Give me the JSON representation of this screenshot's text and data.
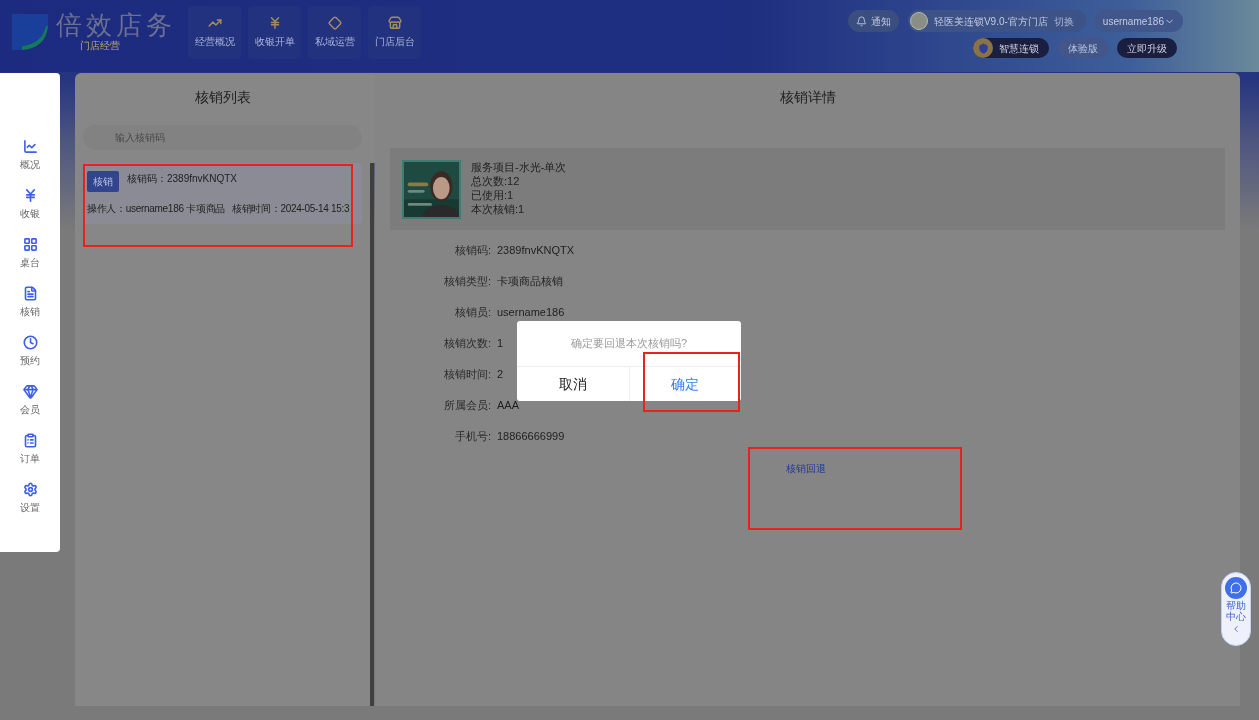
{
  "header": {
    "logo": {
      "title": "倍效店务",
      "subtitle": "门店经营"
    },
    "nav": [
      {
        "label": "经营概况"
      },
      {
        "label": "收银开单"
      },
      {
        "label": "私域运营"
      },
      {
        "label": "门店后台"
      }
    ],
    "notify": "通知",
    "store": "轻医美连锁V9.0-官方门店",
    "switch": "切换",
    "user": "username186",
    "chain_badge": "智慧连锁",
    "edition": "体验版",
    "upgrade": "立即升级"
  },
  "sidebar": {
    "items": [
      {
        "label": "概况"
      },
      {
        "label": "收银"
      },
      {
        "label": "桌台"
      },
      {
        "label": "核销"
      },
      {
        "label": "预约"
      },
      {
        "label": "会员"
      },
      {
        "label": "订单"
      },
      {
        "label": "设置"
      }
    ]
  },
  "list_panel": {
    "title": "核销列表",
    "search": {
      "placeholder": "输入核销码"
    },
    "records": [
      {
        "tag": "核销",
        "code": "核销码：2389fnvKNQTX",
        "operator": "操作人：username186 卡项商品",
        "time": "核销时间：2024-05-14 15:3"
      }
    ]
  },
  "detail_panel": {
    "title": "核销详情",
    "product": {
      "lines": [
        "服务项目-水光-单次",
        "总次数:12",
        "已使用:1",
        "本次核销:1"
      ]
    },
    "fields": [
      {
        "label": "核销码:",
        "value": "2389fnvKNQTX"
      },
      {
        "label": "核销类型:",
        "value": "卡项商品核销"
      },
      {
        "label": "核销员:",
        "value": "username186"
      },
      {
        "label": "核销次数:",
        "value": "1"
      },
      {
        "label": "核销时间:",
        "value": "2"
      },
      {
        "label": "所属会员:",
        "value": "AAA"
      },
      {
        "label": "手机号:",
        "value": "18866666999"
      }
    ],
    "action": "核销回退"
  },
  "dialog": {
    "message": "确定要回退本次核销吗?",
    "buttons": [
      {
        "label": "取消",
        "kind": "cancel"
      },
      {
        "label": "确定",
        "kind": "confirm"
      }
    ]
  },
  "help": {
    "label": "帮助中心"
  }
}
